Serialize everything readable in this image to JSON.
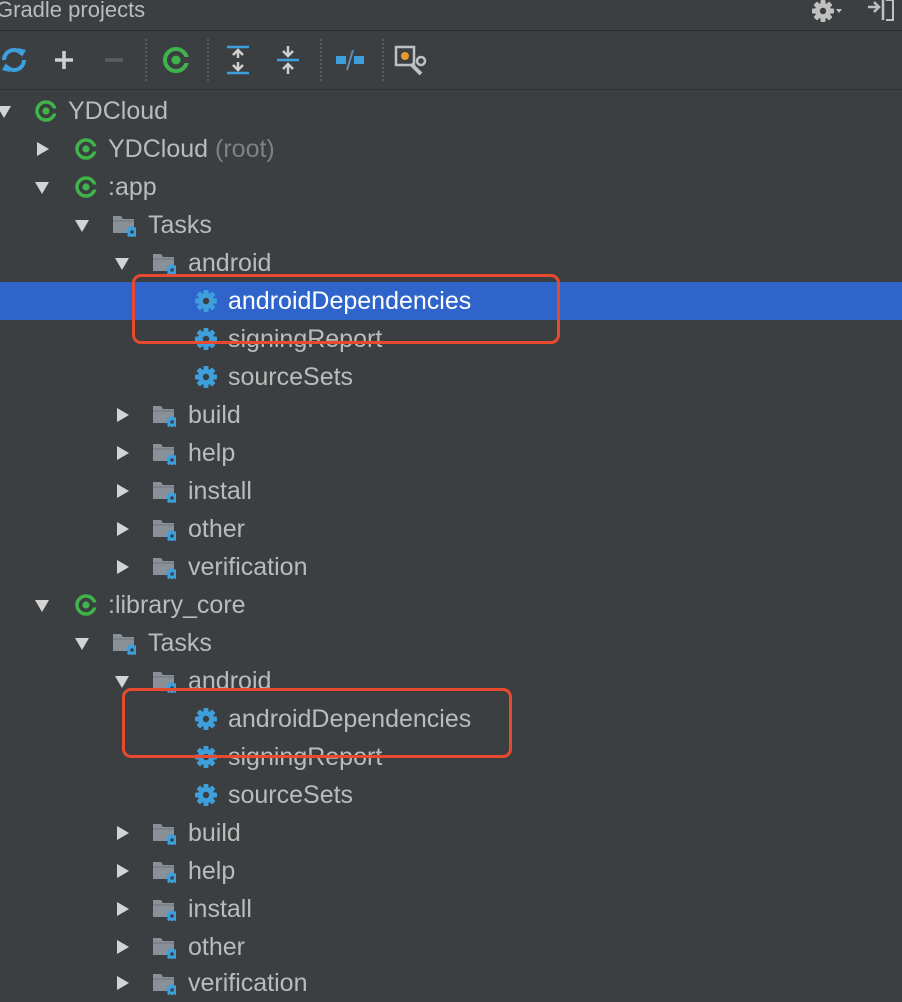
{
  "panel": {
    "title": "Gradle projects"
  },
  "toolbar": {
    "buttons": [
      {
        "name": "refresh-all-icon"
      },
      {
        "name": "add-icon"
      },
      {
        "name": "remove-icon"
      },
      {
        "name": "execute-task-icon"
      },
      {
        "name": "expand-all-icon"
      },
      {
        "name": "collapse-all-icon"
      },
      {
        "name": "toggle-offline-icon"
      },
      {
        "name": "gradle-settings-icon"
      }
    ]
  },
  "tree": {
    "root": {
      "label": "YDCloud"
    },
    "root_module": {
      "label": "YDCloud",
      "suffix": "(root)"
    },
    "app": {
      "label": ":app",
      "tasks_label": "Tasks",
      "android_label": "android",
      "tasks": [
        "androidDependencies",
        "signingReport",
        "sourceSets"
      ],
      "groups": [
        "build",
        "help",
        "install",
        "other",
        "verification"
      ]
    },
    "library_core": {
      "label": ":library_core",
      "tasks_label": "Tasks",
      "android_label": "android",
      "tasks": [
        "androidDependencies",
        "signingReport",
        "sourceSets"
      ],
      "groups": [
        "build",
        "help",
        "install",
        "other",
        "verification"
      ]
    }
  },
  "colors": {
    "background": "#3c3f41",
    "selection": "#2f65ca",
    "highlight_box": "#e84a2f",
    "gradle_green": "#3fb44a",
    "gear_blue": "#3d9fdb"
  }
}
